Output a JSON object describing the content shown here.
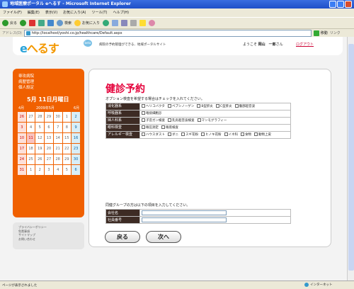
{
  "window": {
    "title": "地域医療ポータル eへるす - Microsoft Internet Explorer"
  },
  "menu": [
    "ファイル(F)",
    "編集(E)",
    "表示(V)",
    "お気に入り(A)",
    "ツール(T)",
    "ヘルプ(H)"
  ],
  "toolbar": {
    "back": "戻る",
    "search": "検索",
    "favorites": "お気に入り"
  },
  "address": {
    "label": "アドレス(D)",
    "url": "http://localhost/yoshi.co.jp/healthcare/Default.aspx",
    "go": "移動",
    "links": "リンク"
  },
  "header": {
    "logo": "eへるす",
    "logo_accent": "e",
    "logo_badge": "beta",
    "tagline": "病院の予約管理ができる、地域ポータルサイト",
    "welcome_prefix": "ようこそ",
    "user": "岡山　一郎",
    "welcome_suffix": "さん",
    "logout": "ログアウト"
  },
  "sidebar": {
    "links": [
      "専攻病院",
      "病歴管理",
      "個人設定"
    ],
    "date": "5月 11日月曜日",
    "cal_header": {
      "prev": "4月",
      "title": "2009年5月",
      "next": "6月"
    },
    "cal": [
      [
        "26",
        "27",
        "28",
        "29",
        "30",
        "1",
        "2"
      ],
      [
        "3",
        "4",
        "5",
        "6",
        "7",
        "8",
        "9"
      ],
      [
        "10",
        "11",
        "12",
        "13",
        "14",
        "15",
        "16"
      ],
      [
        "17",
        "18",
        "19",
        "20",
        "21",
        "22",
        "23"
      ],
      [
        "24",
        "25",
        "26",
        "27",
        "28",
        "29",
        "30"
      ],
      [
        "31",
        "1",
        "2",
        "3",
        "4",
        "5",
        "6"
      ]
    ]
  },
  "footer_links": [
    "プライバシーポリシー",
    "免責事項",
    "サイトマップ",
    "お問い合わせ"
  ],
  "main": {
    "title": "健診予約",
    "note": "オプション検査を希望する場合はチェックを入れてください。",
    "options": [
      {
        "category": "消化器系",
        "items": [
          "ヘリコバクタ",
          "ペプシノーゲン",
          "B型肝炎",
          "C型肝炎",
          "腹部超音波"
        ]
      },
      {
        "category": "呼吸器系",
        "items": [
          "喀痰細胞診"
        ]
      },
      {
        "category": "婦人科系",
        "items": [
          "子宮ガン検査",
          "乳房超音波検査",
          "マンモグラフィー"
        ]
      },
      {
        "category": "眼科検査",
        "items": [
          "眼圧測定",
          "眼底検査"
        ]
      },
      {
        "category": "アレルギー検査",
        "items": [
          "ハウスダスト",
          "ダニ",
          "スギ花粉",
          "ヒノキ花粉",
          "イネ科",
          "食物",
          "動物上皮"
        ]
      }
    ],
    "note2": "同健グループの方は以下の項目を入力してください。",
    "fields": [
      {
        "label": "会社名"
      },
      {
        "label": "社員番号"
      }
    ],
    "back_button": "戻る",
    "next_button": "次へ"
  },
  "status": {
    "text": "ページが表示されました",
    "zone": "インターネット"
  },
  "colors": {
    "accent": "#f06000",
    "title": "#e4003a",
    "label_bg": "#3d2b24"
  }
}
